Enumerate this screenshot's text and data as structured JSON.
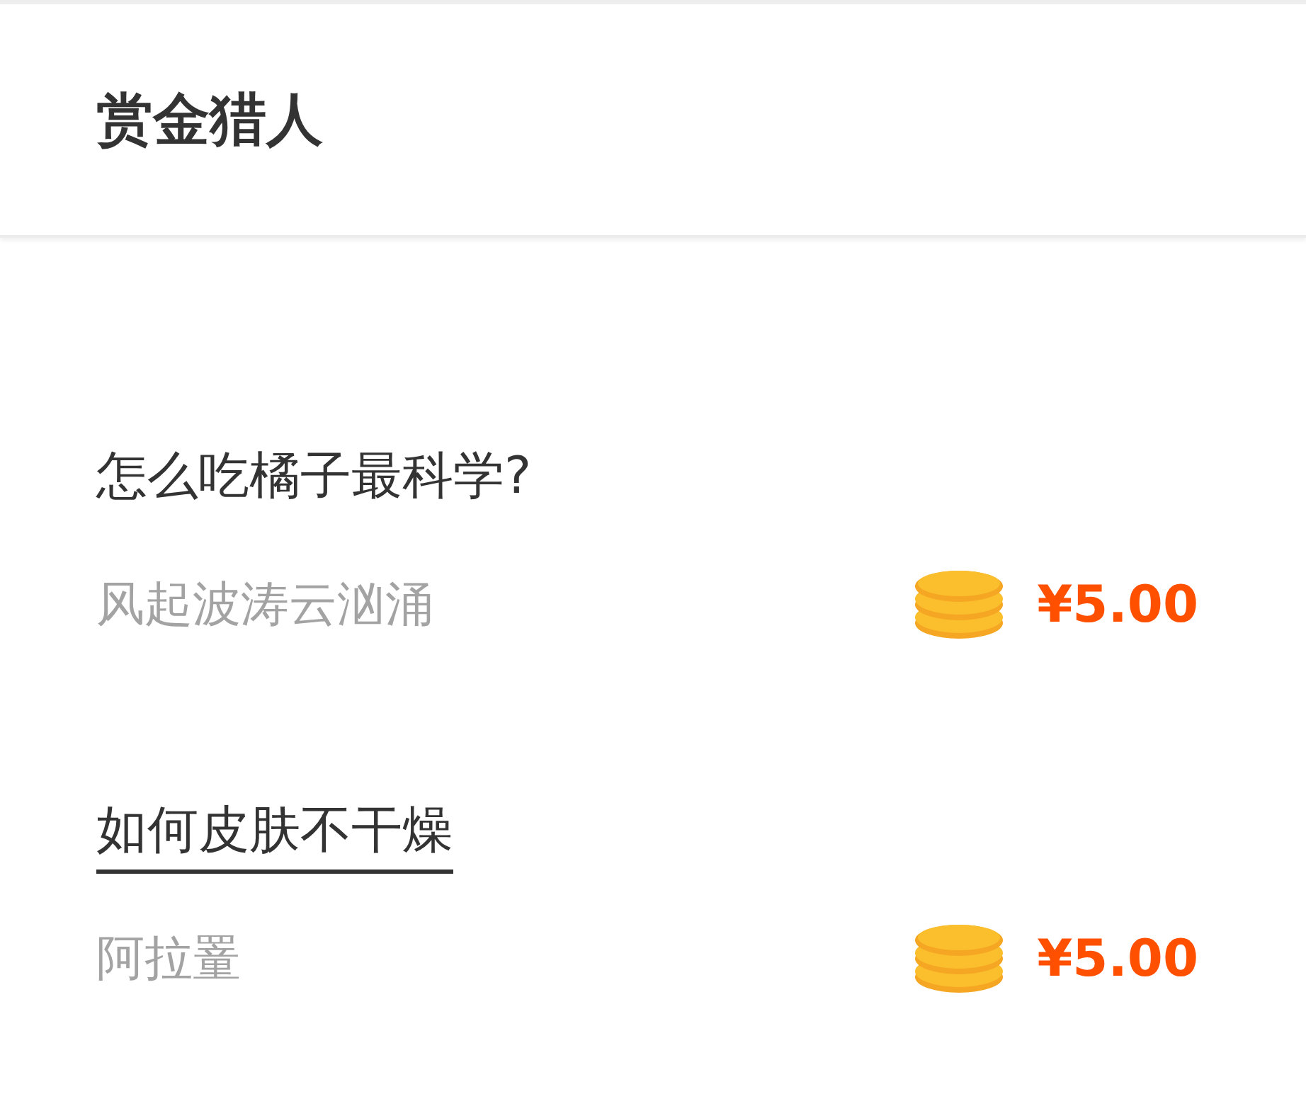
{
  "header": {
    "title": "赏金猎人"
  },
  "items": [
    {
      "title": "怎么吃橘子最科学?",
      "author": "风起波涛云汹涌",
      "price": "¥5.00",
      "underlined": false
    },
    {
      "title": "如何皮肤不干燥",
      "author": "阿拉罿",
      "price": "¥5.00",
      "underlined": true
    }
  ]
}
